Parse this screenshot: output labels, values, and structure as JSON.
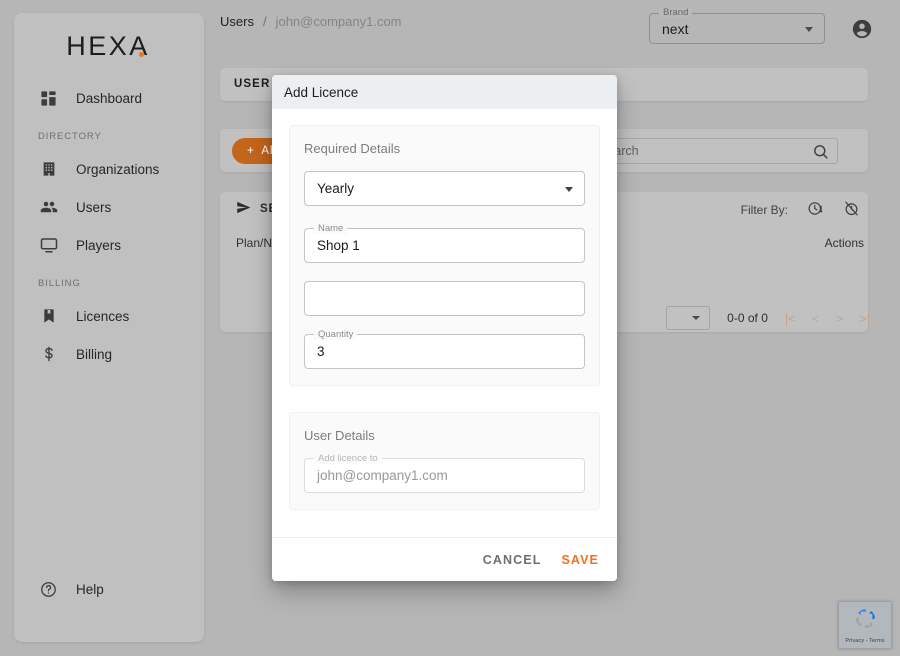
{
  "sidebar": {
    "logo": "HEXA",
    "items": [
      {
        "label": "Dashboard",
        "icon": "dashboard-grid-icon"
      }
    ],
    "sections": [
      {
        "header": "DIRECTORY",
        "items": [
          {
            "label": "Organizations",
            "icon": "building-icon"
          },
          {
            "label": "Users",
            "icon": "people-icon"
          },
          {
            "label": "Players",
            "icon": "monitor-icon"
          }
        ]
      },
      {
        "header": "BILLING",
        "items": [
          {
            "label": "Licences",
            "icon": "bookmark-icon"
          },
          {
            "label": "Billing",
            "icon": "dollar-icon"
          }
        ]
      }
    ],
    "help": {
      "label": "Help",
      "icon": "help-circle-icon"
    }
  },
  "topbar": {
    "breadcrumb": {
      "root": "Users",
      "separator": "/",
      "leaf": "john@company1.com"
    },
    "brand_select": {
      "legend": "Brand",
      "value": "next"
    },
    "account_icon": "account-circle-icon"
  },
  "content": {
    "panel_title": "USER DETAILS",
    "add_button": "ADD",
    "search_placeholder": "Search",
    "send_label": "SEND",
    "filter_label": "Filter By:",
    "filter_icons": [
      "clock-alert-icon",
      "clock-off-icon"
    ],
    "columns": [
      "Plan/No. Displays",
      "Actions"
    ],
    "pagination": {
      "range": "0-0 of 0",
      "first": "|<",
      "prev": "<",
      "next": ">",
      "last": ">|"
    }
  },
  "recaptcha": {
    "terms": "Privacy - Terms"
  },
  "modal": {
    "title": "Add Licence",
    "required_section": {
      "title": "Required Details",
      "plan_select": {
        "value": "Yearly"
      },
      "name_field": {
        "legend": "Name",
        "value": "Shop 1"
      },
      "blank_field": {
        "legend": "",
        "value": ""
      },
      "quantity_field": {
        "legend": "Quantity",
        "value": "3"
      }
    },
    "user_section": {
      "title": "User Details",
      "licence_to_field": {
        "legend": "Add licence to",
        "value": "john@company1.com"
      }
    },
    "cancel_label": "CANCEL",
    "save_label": "SAVE"
  },
  "colors": {
    "accent": "#f4701f",
    "add_button": "#c4651c",
    "logo_dot": "#e07b22"
  }
}
